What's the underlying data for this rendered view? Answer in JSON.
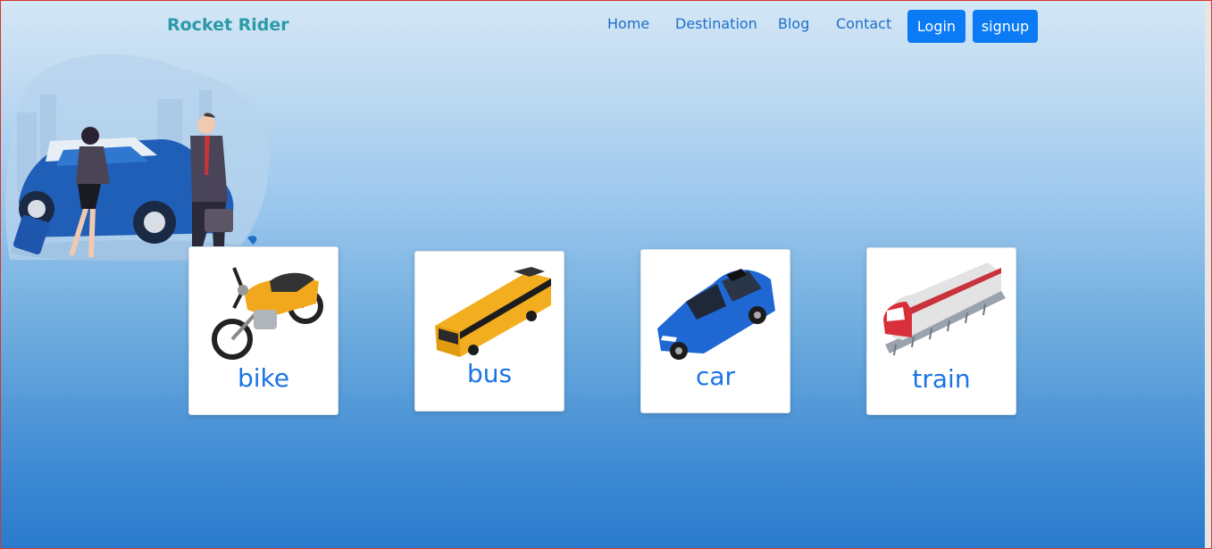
{
  "brand": {
    "name": "Rocket Rider"
  },
  "nav": {
    "items": [
      {
        "label": "Home"
      },
      {
        "label": "Destination"
      },
      {
        "label": "Blog"
      },
      {
        "label": "Contact"
      }
    ],
    "login_label": "Login",
    "signup_label": "signup"
  },
  "hero": {
    "illustration": "travelers-with-car-illustration"
  },
  "vehicles": [
    {
      "label": "bike",
      "icon": "motorcycle-icon"
    },
    {
      "label": "bus",
      "icon": "bus-icon"
    },
    {
      "label": "car",
      "icon": "car-icon"
    },
    {
      "label": "train",
      "icon": "train-icon"
    }
  ],
  "colors": {
    "brand": "#2b9aa8",
    "nav_link": "#1f6fc9",
    "button": "#0b7bf5",
    "card_label": "#1b74e4",
    "bg_top": "#d3e6f5",
    "bg_bottom": "#2a7bcd"
  }
}
